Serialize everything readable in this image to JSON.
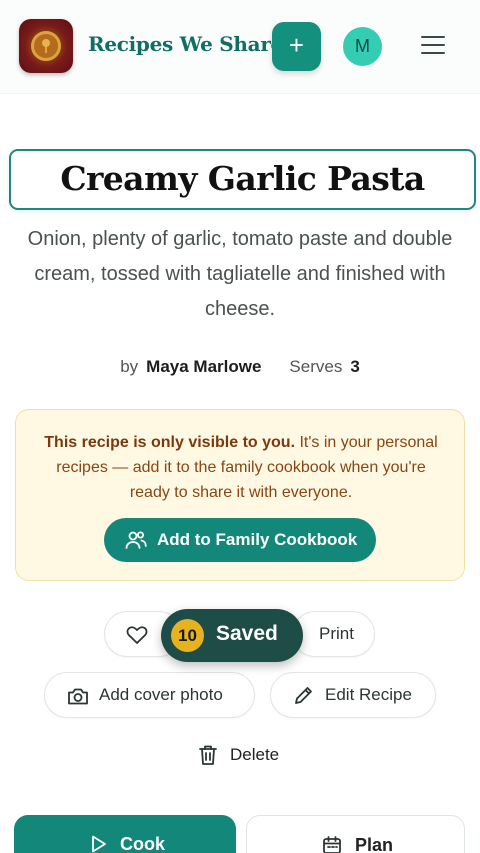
{
  "header": {
    "brand": "Recipes We Share",
    "add_label": "+",
    "avatar_initial": "M"
  },
  "recipe": {
    "title": "Creamy Garlic Pasta",
    "description": "Onion, plenty of garlic, tomato paste and double cream, tossed with tagliatelle and finished with cheese.",
    "by_label": "by",
    "author": "Maya Marlowe",
    "serves_label": "Serves",
    "serves_value": "3"
  },
  "notice": {
    "bold": "This recipe is only visible to you.",
    "text": " It's in your personal recipes — add it to the family cookbook when you're ready to share it with everyone.",
    "button_label": "Add to Family Cookbook"
  },
  "actions": {
    "print_label": "Print",
    "cover_label": "Add cover photo",
    "edit_label": "Edit Recipe",
    "delete_label": "Delete"
  },
  "toast": {
    "count": "10",
    "label": "Saved"
  },
  "bottom": {
    "cook_label": "Cook",
    "plan_label": "Plan"
  },
  "colors": {
    "accent": "#13887a",
    "notice_bg": "#fff9e3",
    "toast_bg": "#1d4d46",
    "badge": "#e7b21f"
  }
}
